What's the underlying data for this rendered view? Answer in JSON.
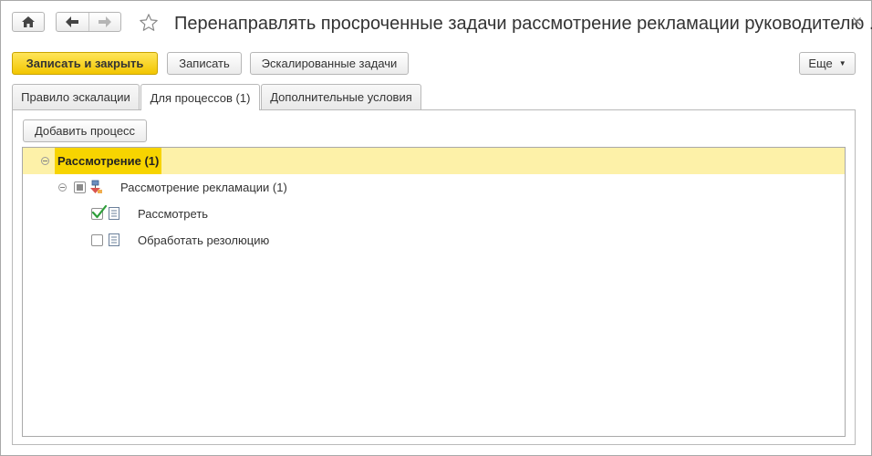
{
  "window": {
    "title": "Перенаправлять просроченные задачи рассмотрение рекламации руководителю ..."
  },
  "toolbar": {
    "save_close_label": "Записать и закрыть",
    "save_label": "Записать",
    "escalated_label": "Эскалированные задачи",
    "more_label": "Еще"
  },
  "tabs": [
    {
      "label": "Правило эскалации",
      "active": false
    },
    {
      "label": "Для процессов (1)",
      "active": true
    },
    {
      "label": "Дополнительные условия",
      "active": false
    }
  ],
  "panel": {
    "add_process_label": "Добавить процесс"
  },
  "tree": {
    "group": {
      "label": "Рассмотрение (1)",
      "expanded": true
    },
    "process": {
      "label": "Рассмотрение рекламации (1)",
      "checked": "partial",
      "expanded": true
    },
    "tasks": [
      {
        "label": "Рассмотреть",
        "checked": true
      },
      {
        "label": "Обработать резолюцию",
        "checked": false
      }
    ]
  },
  "colors": {
    "accent_yellow": "#f7d400",
    "selected_row": "#fdf1a8",
    "check_green": "#2e9e3a"
  },
  "icons": [
    "home-icon",
    "arrow-left-icon",
    "arrow-right-icon",
    "star-icon",
    "close-icon",
    "caret-down-icon",
    "process-icon",
    "task-icon"
  ]
}
